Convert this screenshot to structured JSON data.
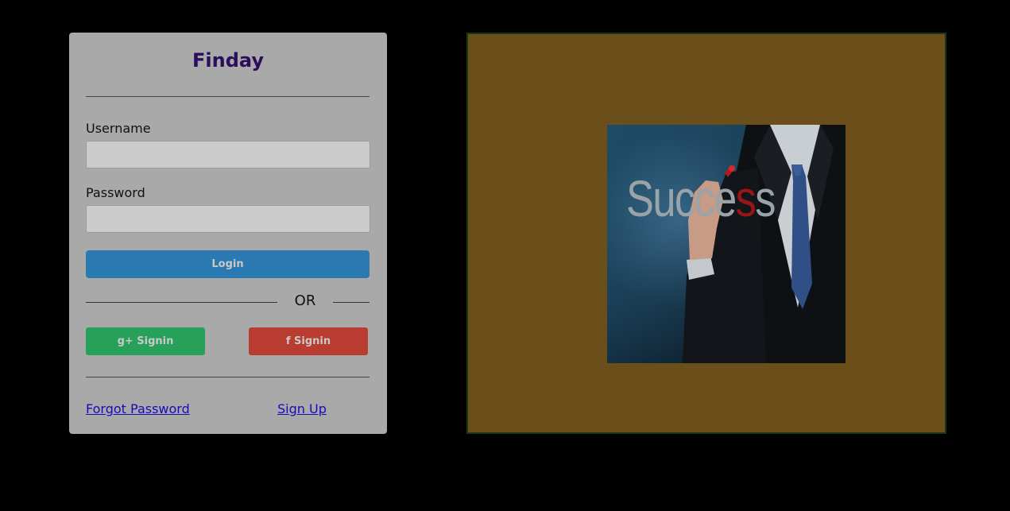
{
  "login": {
    "title": "Finday",
    "username_label": "Username",
    "username_value": "",
    "password_label": "Password",
    "password_value": "",
    "login_button": "Login",
    "or_text": "OR",
    "google_button": "g+ Signin",
    "facebook_button": "f Signin",
    "forgot_password_link": "Forgot Password",
    "sign_up_link": "Sign Up"
  },
  "image_panel": {
    "photo_text_start": "Succe",
    "photo_text_red": "s",
    "photo_text_end": "s"
  },
  "colors": {
    "background": "#000000",
    "card": "#a9a9a9",
    "title": "#2b0d5e",
    "login_button": "#2a79b0",
    "google_button": "#27a15a",
    "facebook_button": "#b83c30",
    "link": "#1a0ab8",
    "image_panel": "#6a4f1b",
    "image_panel_border": "#173a12"
  }
}
